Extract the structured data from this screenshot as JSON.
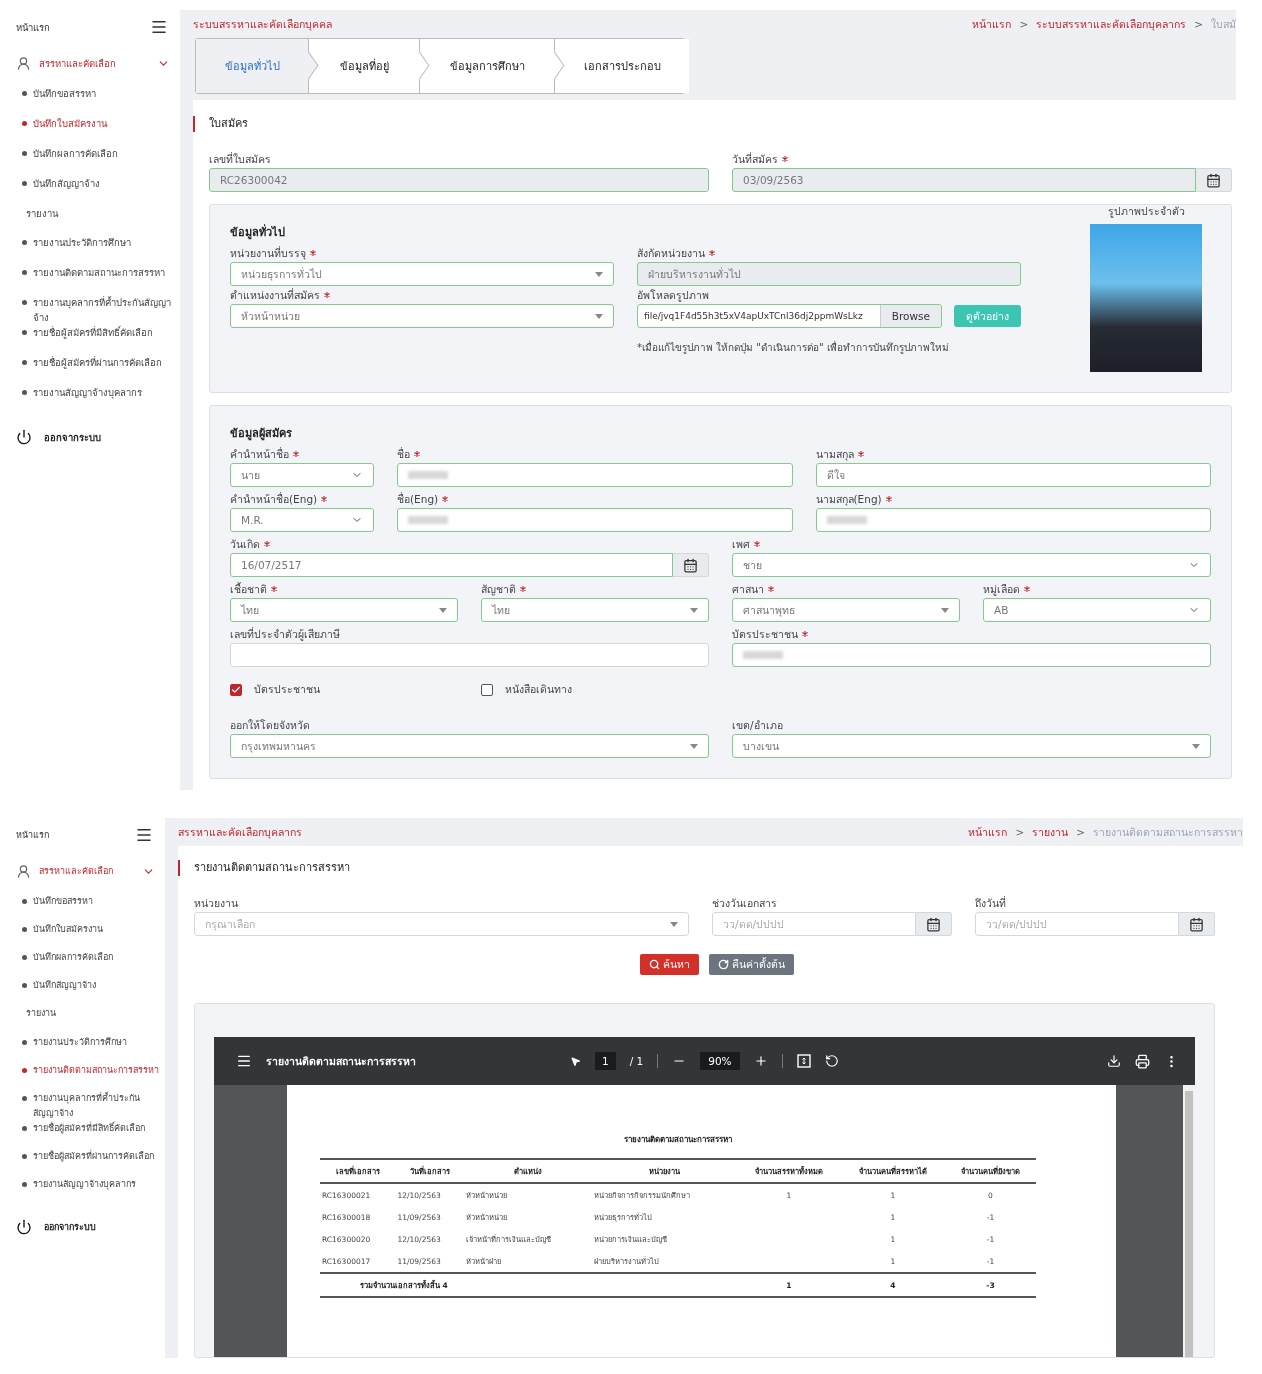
{
  "application_screen": {
    "sidebar": {
      "home": "หน้าแรก",
      "group": {
        "label": "สรรหาและคัดเลือก",
        "expanded": true
      },
      "items": [
        {
          "label": "บันทึกขอสรรหา",
          "selected": false
        },
        {
          "label": "บันทึกใบสมัครงาน",
          "selected": true
        },
        {
          "label": "บันทึกผลการคัดเลือก",
          "selected": false
        },
        {
          "label": "บันทึกสัญญาจ้าง",
          "selected": false
        }
      ],
      "section": "รายงาน",
      "report_items": [
        {
          "label": "รายงานประวัติการศึกษา",
          "selected": false
        },
        {
          "label": "รายงานติดตามสถานะการสรรหา",
          "selected": false
        },
        {
          "label": "รายงานบุคลากรที่ค้ำประกันสัญญาจ้าง",
          "selected": false
        },
        {
          "label": "รายชื่อผู้สมัครที่มีสิทธิ์คัดเลือก",
          "selected": false
        },
        {
          "label": "รายชื่อผู้สมัครที่ผ่านการคัดเลือก",
          "selected": false
        },
        {
          "label": "รายงานสัญญาจ้างบุคลากร",
          "selected": false
        }
      ],
      "logout": "ออกจากระบบ"
    },
    "system_title": "ระบบสรรหาและคัดเลือกบุคคล",
    "breadcrumb": [
      {
        "label": "หน้าแรก",
        "current": false
      },
      {
        "separator": ">",
        "label": "ระบบสรรหาและคัดเลือกบุคลากร",
        "current": false
      },
      {
        "separator": ">",
        "label": "ใบสมั",
        "current": true
      }
    ],
    "steps": [
      {
        "label": "ข้อมูลทั่วไป",
        "selected": true
      },
      {
        "label": "ข้อมูลที่อยู่",
        "selected": false
      },
      {
        "label": "ข้อมูลการศึกษา",
        "selected": false
      },
      {
        "label": "เอกสารประกอบ",
        "selected": false
      }
    ],
    "section_title": "ใบสมัคร",
    "header_fields": [
      {
        "kind": "text",
        "label": "เลขที่ใบสมัคร",
        "required": false,
        "readonly": true,
        "valid": true,
        "value": "RC26300042"
      },
      {
        "kind": "date",
        "label": "วันที่สมัคร",
        "required": true,
        "readonly": true,
        "valid": true,
        "value": "03/09/2563"
      }
    ],
    "general": {
      "title": "ข้อมูลทั่วไป",
      "photo_label": "รูปภาพประจำตัว",
      "fields": [
        {
          "kind": "select",
          "label": "หน่วยงานที่บรรจุ",
          "required": true,
          "readonly": false,
          "valid": true,
          "value": "หน่วยธุรการทั่วไป"
        },
        {
          "kind": "text",
          "label": "สังกัดหน่วยงาน",
          "required": true,
          "readonly": true,
          "valid": true,
          "value": "ฝ่ายบริหารงานทั่วไป"
        },
        {
          "kind": "select",
          "label": "ตำแหน่งงานที่สมัคร",
          "required": true,
          "readonly": false,
          "valid": true,
          "value": "หัวหน้าหน่วย"
        },
        {
          "kind": "file",
          "label": "อัพโหลดรูปภาพ",
          "required": false,
          "readonly": false,
          "valid": true,
          "value": "file/jvq1F4d55h3t5xV4apUxTCnl36dj2ppmWsLkz",
          "button": "Browse",
          "preview": "ดูตัวอย่าง",
          "note": "*เมื่อแก้ไขรูปภาพ ให้กดปุ่ม \"ดำเนินการต่อ\" เพื่อทำการบันทึกรูปภาพใหม่"
        }
      ]
    },
    "applicant": {
      "title": "ข้อมูลผู้สมัคร",
      "rows": [
        [
          {
            "kind": "dropdown",
            "label": "คำนำหน้าชื่อ",
            "required": true,
            "readonly": false,
            "valid": true,
            "value": "นาย"
          },
          {
            "kind": "text",
            "label": "ชื่อ",
            "required": true,
            "readonly": false,
            "valid": true,
            "redacted": true
          },
          {
            "kind": "text",
            "label": "นามสกุล",
            "required": true,
            "readonly": false,
            "valid": true,
            "value": "ดีใจ"
          }
        ],
        [
          {
            "kind": "dropdown",
            "label": "คำนำหน้าชื่อ(Eng)",
            "required": true,
            "readonly": false,
            "valid": true,
            "value": "M.R."
          },
          {
            "kind": "text",
            "label": "ชื่อ(Eng)",
            "required": true,
            "readonly": false,
            "valid": true,
            "redacted": true
          },
          {
            "kind": "text",
            "label": "นามสกุล(Eng)",
            "required": true,
            "readonly": false,
            "valid": true,
            "redacted": true
          }
        ],
        [
          {
            "kind": "date",
            "label": "วันเกิด",
            "required": true,
            "readonly": false,
            "valid": true,
            "value": "16/07/2517"
          },
          {
            "kind": "dropdown",
            "label": "เพศ",
            "required": true,
            "readonly": false,
            "valid": true,
            "value": "ชาย"
          }
        ],
        [
          {
            "kind": "select",
            "label": "เชื้อชาติ",
            "required": true,
            "readonly": false,
            "valid": true,
            "value": "ไทย"
          },
          {
            "kind": "select",
            "label": "สัญชาติ",
            "required": true,
            "readonly": false,
            "valid": true,
            "value": "ไทย"
          },
          {
            "kind": "select",
            "label": "ศาสนา",
            "required": true,
            "readonly": false,
            "valid": true,
            "value": "ศาสนาพุทธ"
          },
          {
            "kind": "dropdown",
            "label": "หมู่เลือด",
            "required": true,
            "readonly": false,
            "valid": true,
            "value": "AB"
          }
        ],
        [
          {
            "kind": "text",
            "label": "เลขที่ประจำตัวผู้เสียภาษี",
            "required": false,
            "readonly": false,
            "valid": false
          },
          {
            "kind": "text",
            "label": "บัตรประชาชน",
            "required": true,
            "readonly": false,
            "valid": true,
            "redacted": true
          }
        ]
      ],
      "id_types": [
        {
          "label": "บัตรประชาชน",
          "checked": true
        },
        {
          "label": "หนังสือเดินทาง",
          "checked": false
        }
      ],
      "issuer_row": [
        {
          "kind": "select",
          "label": "ออกให้โดยจังหวัด",
          "required": false,
          "readonly": false,
          "valid": true,
          "value": "กรุงเทพมหานคร"
        },
        {
          "kind": "select",
          "label": "เขต/อำเภอ",
          "required": false,
          "readonly": false,
          "valid": true,
          "value": "บางเขน"
        }
      ]
    }
  },
  "report_screen": {
    "sidebar": {
      "home": "หน้าแรก",
      "group": {
        "label": "สรรหาและคัดเลือก",
        "expanded": true
      },
      "items": [
        {
          "label": "บันทึกขอสรรหา",
          "selected": false
        },
        {
          "label": "บันทึกใบสมัครงาน",
          "selected": false
        },
        {
          "label": "บันทึกผลการคัดเลือก",
          "selected": false
        },
        {
          "label": "บันทึกสัญญาจ้าง",
          "selected": false
        }
      ],
      "section": "รายงาน",
      "report_items": [
        {
          "label": "รายงานประวัติการศึกษา",
          "selected": false
        },
        {
          "label": "รายงานติดตามสถานะการสรรหา",
          "selected": true
        },
        {
          "label": "รายงานบุคลากรที่ค้ำประกันสัญญาจ้าง",
          "selected": false
        },
        {
          "label": "รายชื่อผู้สมัครที่มีสิทธิ์คัดเลือก",
          "selected": false
        },
        {
          "label": "รายชื่อผู้สมัครที่ผ่านการคัดเลือก",
          "selected": false
        },
        {
          "label": "รายงานสัญญาจ้างบุคลากร",
          "selected": false
        }
      ],
      "logout": "ออกจากระบบ"
    },
    "system_title": "สรรหาและคัดเลือกบุคลากร",
    "breadcrumb": [
      {
        "label": "หน้าแรก",
        "current": false
      },
      {
        "separator": ">",
        "label": "รายงาน",
        "current": false
      },
      {
        "separator": ">",
        "label": "รายงานติดตามสถานะการสรรหา",
        "current": true
      }
    ],
    "section_title": "รายงานติดตามสถานะการสรรหา",
    "filters": [
      {
        "kind": "select",
        "label": "หน่วยงาน",
        "required": false,
        "readonly": false,
        "valid": false,
        "placeholder": "กรุณาเลือก"
      },
      {
        "kind": "date",
        "label": "ช่วงวันเอกสาร",
        "required": false,
        "readonly": false,
        "valid": false,
        "placeholder": "วว/ดด/ปปปป"
      },
      {
        "kind": "date",
        "label": "ถึงวันที่",
        "required": false,
        "readonly": false,
        "valid": false,
        "placeholder": "วว/ดด/ปปปป"
      }
    ],
    "buttons": [
      {
        "kind": "search",
        "label": "ค้นหา"
      },
      {
        "kind": "reset",
        "label": "คืนค่าตั้งต้น"
      }
    ],
    "viewer": {
      "title": "รายงานติดตามสถานะการสรรหา",
      "page": "1",
      "page_total": "/ 1",
      "zoom": "90%",
      "document": {
        "title": "รายงานติดตามสถานะการสรรหา",
        "columns": [
          "เลขที่เอกสาร",
          "วันที่เอกสาร",
          "ตำแหน่ง",
          "หน่วยงาน",
          "จำนวนสรรหาทั้งหมด",
          "จำนวนคนที่สรรหาได้",
          "จำนวนคนที่ยังขาด"
        ],
        "rows": [
          [
            "RC16300021",
            "12/10/2563",
            "หัวหน้าหน่วย",
            "หน่วยกิจการกิจกรรมนักศึกษา",
            "1",
            "1",
            "0"
          ],
          [
            "RC16300018",
            "11/09/2563",
            "หัวหน้าหน่วย",
            "หน่วยธุรการทั่วไป",
            null,
            "1",
            "-1"
          ],
          [
            "RC16300020",
            "12/10/2563",
            "เจ้าหน้าที่การเงินและบัญชี",
            "หน่วยการเงินและบัญชี",
            null,
            "1",
            "-1"
          ],
          [
            "RC16300017",
            "11/09/2563",
            "หัวหน้าฝ่าย",
            "ฝ่ายบริหารงานทั่วไป",
            null,
            "1",
            "-1"
          ]
        ],
        "total": {
          "label": "รวมจำนวนเอกสารทั้งสิ้น 4",
          "cells": [
            "1",
            "4",
            "-3"
          ]
        }
      }
    }
  }
}
